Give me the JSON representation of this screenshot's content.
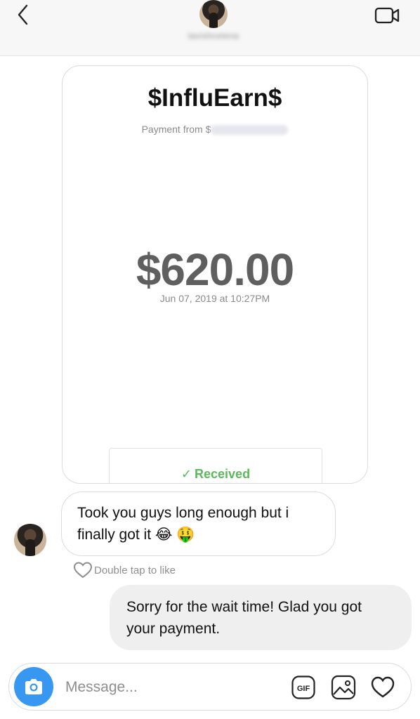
{
  "header": {
    "username": "tavishcelena",
    "icons": {
      "back": "chevron-left-icon",
      "video": "video-camera-icon"
    }
  },
  "payment_card": {
    "brand": "$InfluEarn$",
    "payment_from_label": "Payment from $",
    "amount": "$620.00",
    "date": "Jun 07, 2019 at 10:27PM",
    "status_check": "✓",
    "status": "Received",
    "status_color": "#5cb85c"
  },
  "messages": [
    {
      "direction": "incoming",
      "line1": "Took you guys long enough but i",
      "line2": "finally got it",
      "emojis": "😂 🤑"
    },
    {
      "direction": "outgoing",
      "line1": "Sorry for the wait time! Glad you got",
      "line2": "your payment."
    }
  ],
  "like_hint": "Double tap to like",
  "composer": {
    "placeholder": "Message...",
    "gif_label": "GIF",
    "accent": "#3897f0",
    "icons": [
      "camera-icon",
      "gif-icon",
      "photo-icon",
      "heart-icon"
    ]
  }
}
